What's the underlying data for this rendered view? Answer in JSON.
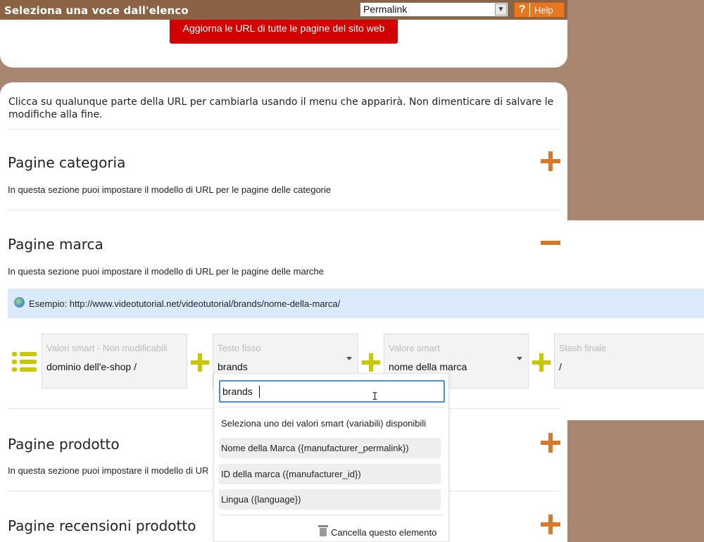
{
  "topbar": {
    "title": "Seleziona una voce dall'elenco",
    "select_value": "Permalink",
    "help_label": "Help",
    "help_icon_glyph": "?"
  },
  "update_button": "Aggiorna le URL di tutte le pagine del sito web",
  "intro_text": "Clicca su qualunque parte della URL per cambiarla usando il menu che apparirà. Non dimenticare di salvare le modifiche alla fine.",
  "sections": {
    "category": {
      "title": "Pagine categoria",
      "desc": "In questa sezione puoi impostare il modello di URL per le pagine delle categorie"
    },
    "brand": {
      "title": "Pagine marca",
      "desc": "In questa sezione puoi impostare il modello di URL per le pagine delle marche",
      "example": "Esempio: http://www.videotutorial.net/videotutorial/brands/nome-della-marca/"
    },
    "product": {
      "title": "Pagine prodotto",
      "desc": "In questa sezione puoi impostare il modello di UR"
    },
    "reviews": {
      "title": "Pagine recensioni prodotto"
    }
  },
  "url_builder": {
    "parts": [
      {
        "caption": "Valori smart - Non modificabili",
        "value": "dominio dell'e-shop /"
      },
      {
        "caption": "Testo fisso",
        "value": "brands"
      },
      {
        "caption": "Valore smart",
        "value": "nome della marca"
      },
      {
        "caption": "Slash finale",
        "value": "/"
      }
    ]
  },
  "dropdown": {
    "input_value": "brands",
    "hint": "Seleziona uno dei valori smart (variabili) disponibili",
    "options": [
      "Nome della Marca ({manufacturer_permalink})",
      "ID della marca ({manufacturer_id})",
      "Lingua ({language})"
    ],
    "delete_label": "Cancella questo elemento"
  },
  "colors": {
    "topbar": "#8c6244",
    "background": "#a88670",
    "update_button": "#d20000",
    "toggle_orange": "#d47a2a",
    "accent_yellow": "#c8c800",
    "example_bg": "#dbeafa"
  }
}
